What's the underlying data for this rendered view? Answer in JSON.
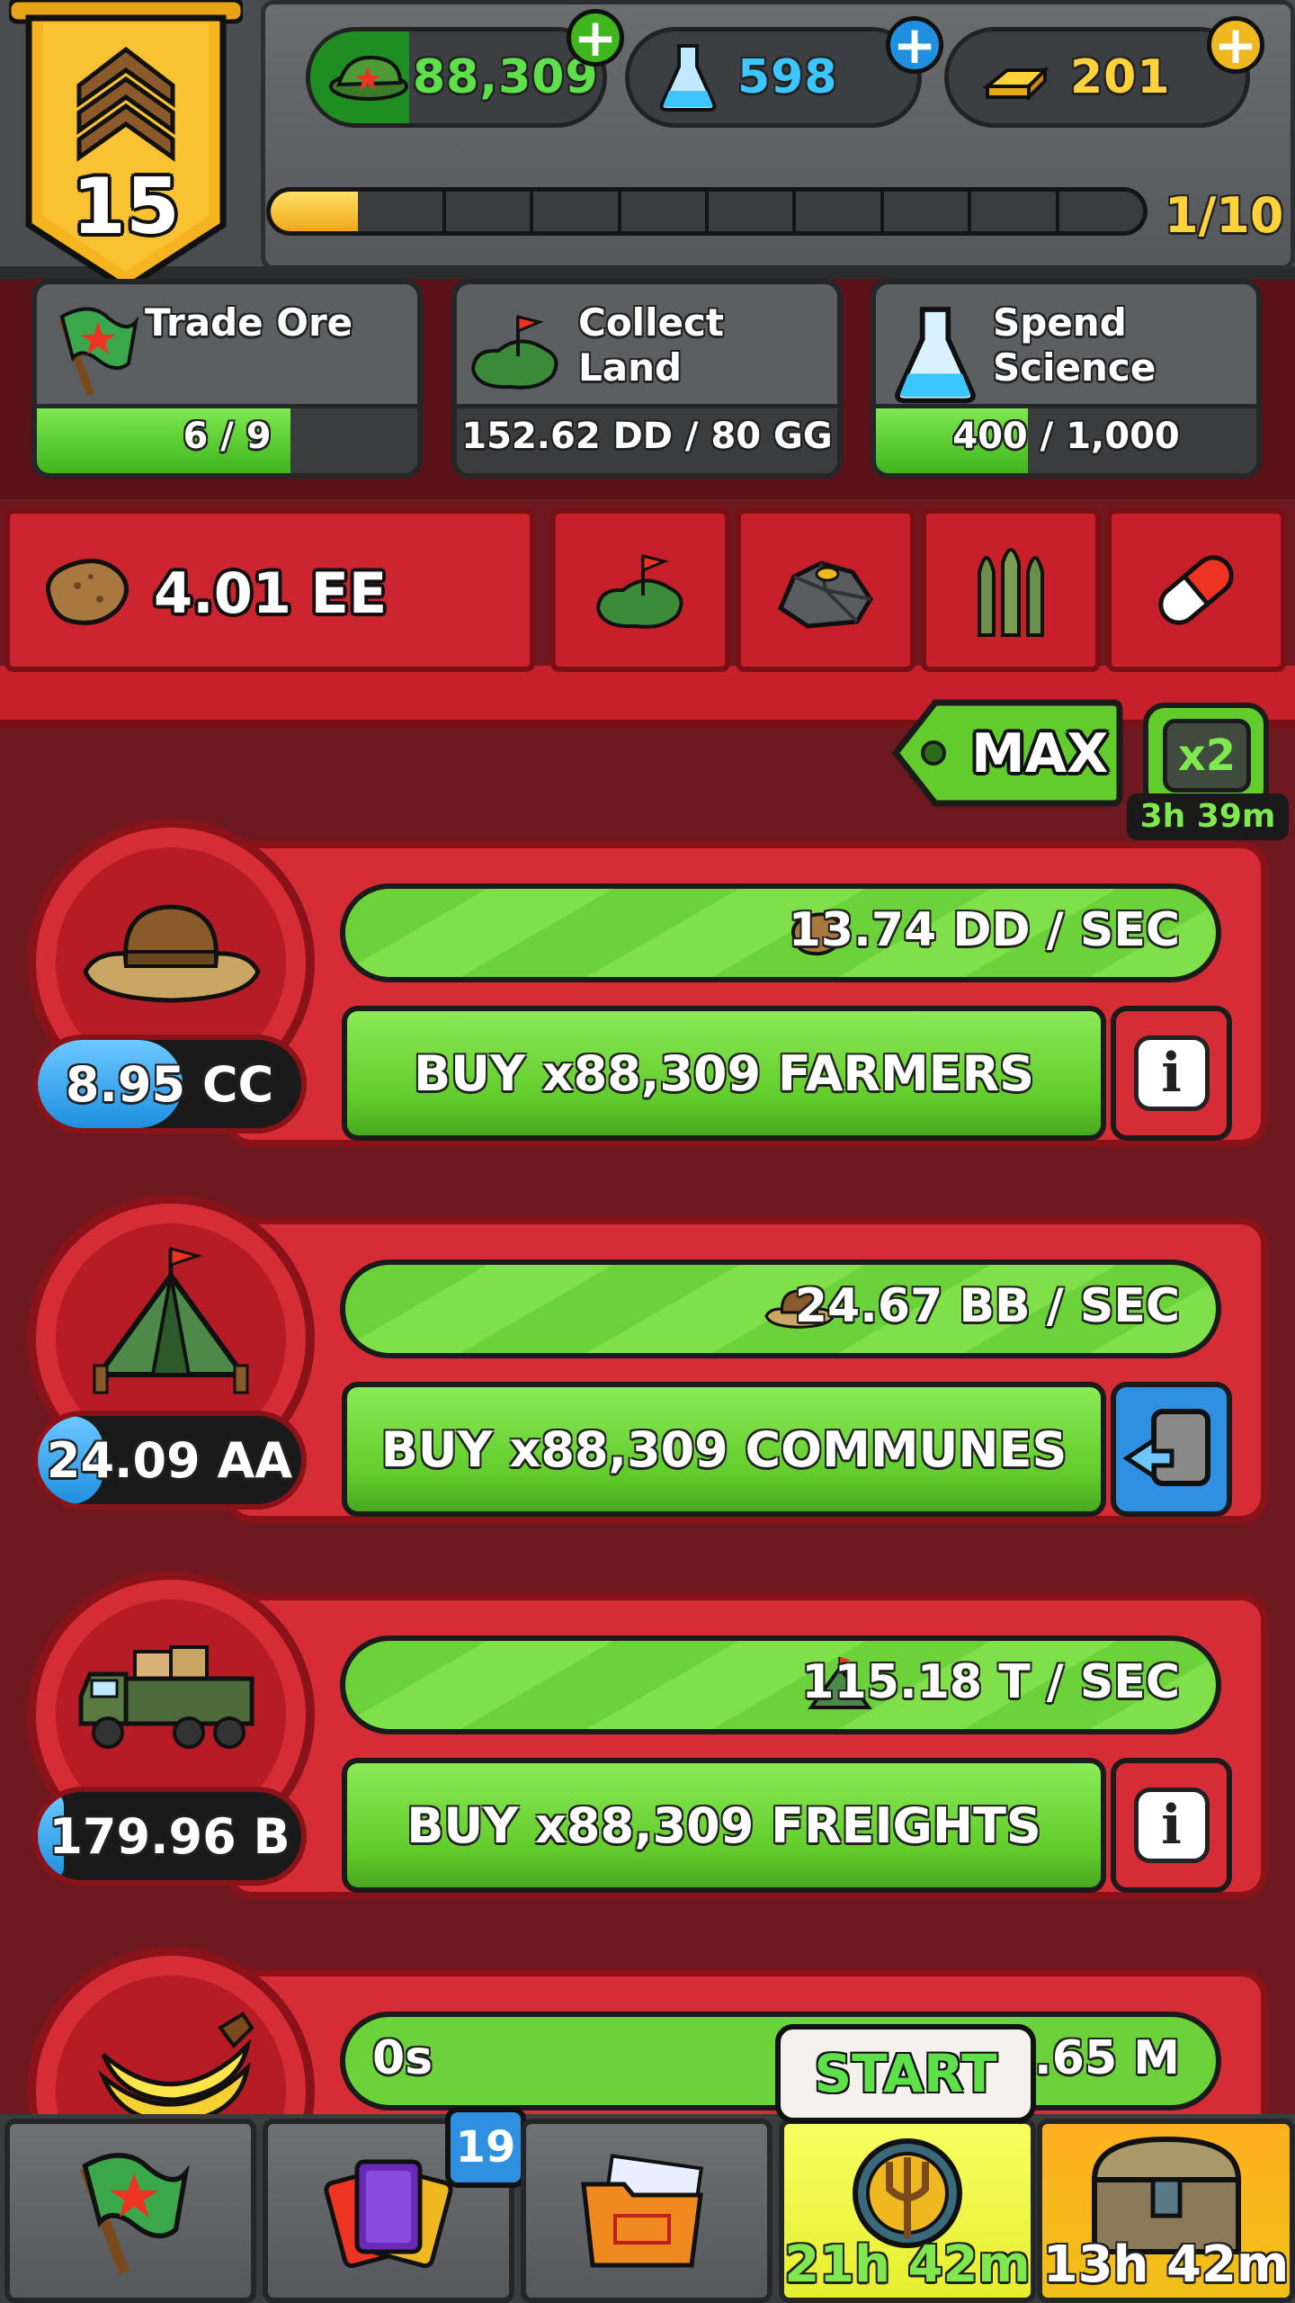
{
  "rank": {
    "level": "15"
  },
  "currencies": [
    {
      "name": "cash",
      "icon": "army-cap-icon",
      "value": "88,309",
      "color": "#5ee04a"
    },
    {
      "name": "science",
      "icon": "flask-icon",
      "value": "598",
      "color": "#3cc6ff"
    },
    {
      "name": "gold",
      "icon": "gold-bars-icon",
      "value": "201",
      "color": "#ffd23a"
    }
  ],
  "xp": {
    "label": "1/10",
    "progress": 0.1
  },
  "quests": [
    {
      "title_line1": "Trade Ore",
      "title_line2": "",
      "progress_text": "6 / 9",
      "progress": 0.667,
      "icon": "comrade-flag-icon"
    },
    {
      "title_line1": "Collect Land",
      "title_line2": "",
      "progress_text": "152.62 DD / 80 GG",
      "progress": 0.0,
      "icon": "land-icon"
    },
    {
      "title_line1": "Spend",
      "title_line2": "Science",
      "progress_text": "400 / 1,000",
      "progress": 0.4,
      "icon": "flask-icon"
    }
  ],
  "resource": {
    "amount": "4.01 EE",
    "icon": "potato-icon"
  },
  "category_tabs": [
    {
      "name": "land",
      "icon": "land-icon"
    },
    {
      "name": "ore",
      "icon": "ore-icon"
    },
    {
      "name": "ammo",
      "icon": "bullets-icon"
    },
    {
      "name": "medicine",
      "icon": "pill-icon"
    }
  ],
  "multiplier": {
    "max_label": "MAX",
    "boost_label": "x2",
    "boost_timer": "3h 39m"
  },
  "generators": [
    {
      "name": "farmers",
      "icon": "straw-hat-icon",
      "rate": "13.74 DD / SEC",
      "rate_icon": "potato-icon",
      "buy_label": "BUY x88,309 FARMERS",
      "cost": "8.95 CC",
      "cost_progress": 0.55,
      "side_button": "info"
    },
    {
      "name": "communes",
      "icon": "tent-icon",
      "rate": "24.67 BB / SEC",
      "rate_icon": "straw-hat-icon",
      "buy_label": "BUY x88,309 COMMUNES",
      "cost": "24.09 AA",
      "cost_progress": 0.25,
      "side_button": "swap"
    },
    {
      "name": "freights",
      "icon": "truck-icon",
      "rate": "115.18 T / SEC",
      "rate_icon": "tent-icon",
      "buy_label": "BUY x88,309 FREIGHTS",
      "cost": "179.96 B",
      "cost_progress": 0.1,
      "side_button": "info"
    },
    {
      "name": "bananas",
      "icon": "banana-icon",
      "timer": "0s",
      "rate": "8.65 M",
      "rate_icon": ""
    }
  ],
  "bottom_nav": [
    {
      "name": "missions",
      "icon": "comrade-flag-icon"
    },
    {
      "name": "cards",
      "icon": "cards-icon",
      "badge": "19"
    },
    {
      "name": "dossier",
      "icon": "folder-icon"
    },
    {
      "name": "event",
      "icon": "trident-icon",
      "tooltip": "START",
      "timer": "21h 42m"
    },
    {
      "name": "chests",
      "icon": "chest-icon",
      "timer": "13h 42m"
    }
  ]
}
